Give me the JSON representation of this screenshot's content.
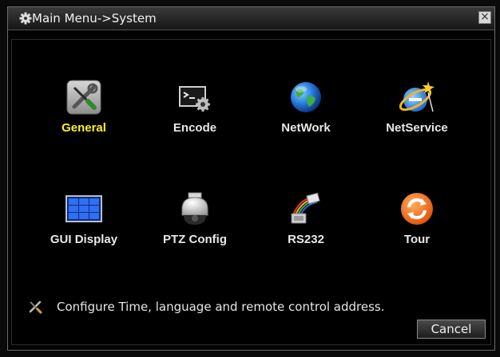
{
  "window": {
    "title": "Main Menu->System",
    "close_glyph": "×"
  },
  "items": [
    {
      "label": "General",
      "icon": "tools-icon",
      "selected": true
    },
    {
      "label": "Encode",
      "icon": "terminal-gear-icon",
      "selected": false
    },
    {
      "label": "NetWork",
      "icon": "globe-icon",
      "selected": false
    },
    {
      "label": "NetService",
      "icon": "ie-globe-icon",
      "selected": false
    },
    {
      "label": "GUI Display",
      "icon": "display-grid-icon",
      "selected": false
    },
    {
      "label": "PTZ Config",
      "icon": "dome-camera-icon",
      "selected": false
    },
    {
      "label": "RS232",
      "icon": "serial-cable-icon",
      "selected": false
    },
    {
      "label": "Tour",
      "icon": "refresh-icon",
      "selected": false
    }
  ],
  "hint": {
    "icon": "tools-small-icon",
    "text": "Configure Time, language and remote control address."
  },
  "cancel_label": "Cancel",
  "colors": {
    "selected_label": "#ffef2a",
    "label": "#e8e8e8",
    "background": "#000000"
  }
}
